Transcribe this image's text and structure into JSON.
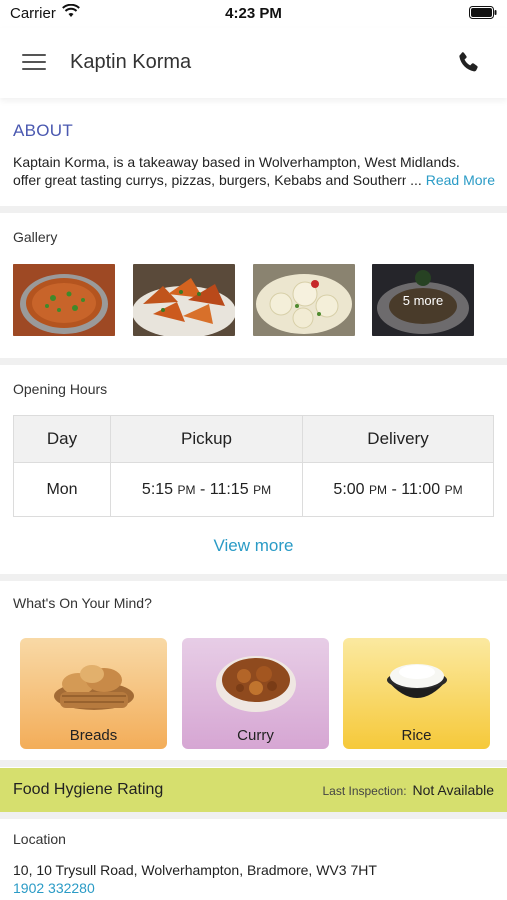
{
  "status_bar": {
    "carrier": "Carrier",
    "time": "4:23 PM"
  },
  "header": {
    "title": "Kaptin Korma"
  },
  "about": {
    "heading": "ABOUT",
    "line1": "Kaptain Korma, is a takeaway based in Wolverhampton, West Midlands.",
    "line2": "offer great tasting currys, pizzas, burgers, Kebabs and Southern",
    "ellipsis": "...",
    "read_more": "Read More"
  },
  "gallery": {
    "title": "Gallery",
    "more_label": "5 more"
  },
  "opening_hours": {
    "title": "Opening Hours",
    "columns": [
      "Day",
      "Pickup",
      "Delivery"
    ],
    "rows": [
      {
        "day": "Mon",
        "pickup_start": "5:15",
        "pickup_start_ampm": "PM",
        "pickup_end": "11:15",
        "pickup_end_ampm": "PM",
        "delivery_start": "5:00",
        "delivery_start_ampm": "PM",
        "delivery_end": "11:00",
        "delivery_end_ampm": "PM"
      }
    ],
    "separator": "-",
    "view_more": "View more"
  },
  "categories": {
    "title": "What's On Your Mind?",
    "items": [
      {
        "label": "Breads"
      },
      {
        "label": "Curry"
      },
      {
        "label": "Rice"
      }
    ]
  },
  "hygiene": {
    "title": "Food Hygiene Rating",
    "last_inspection_label": "Last Inspection:",
    "last_inspection_value": "Not Available"
  },
  "location": {
    "title": "Location",
    "address": "10, 10 Trysull Road, Wolverhampton, Bradmore, WV3 7HT",
    "phone": "1902 332280"
  },
  "colors": {
    "accent": "#2a9bc6",
    "about_heading": "#4a58b0",
    "hygiene_bg": "#d6df6e",
    "breads_card": "#f6c27a",
    "curry_card": "#e3bfe0",
    "rice_card": "#f9d767"
  }
}
